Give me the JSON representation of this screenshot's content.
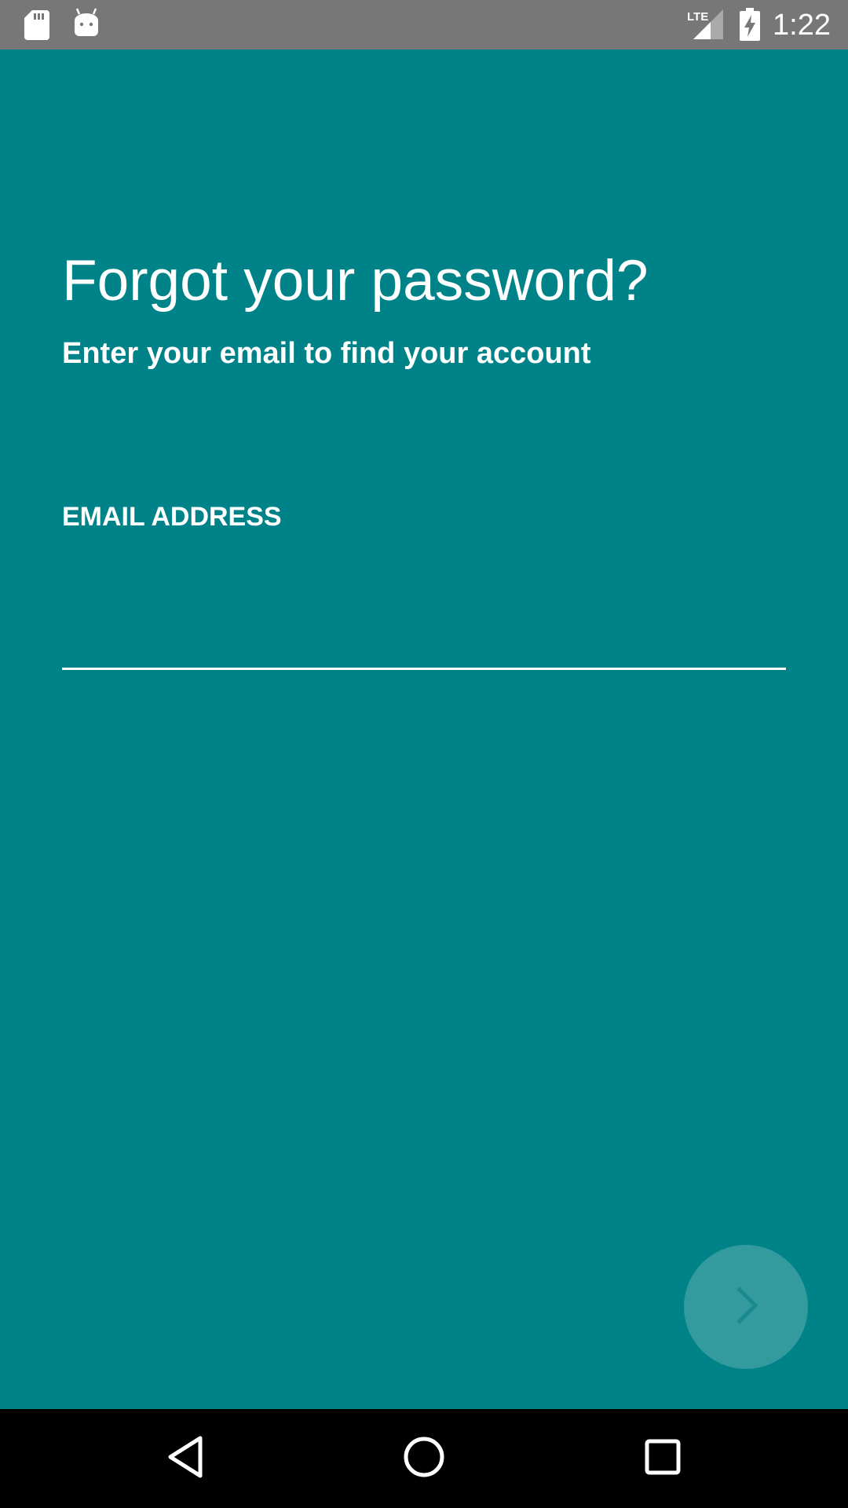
{
  "status_bar": {
    "time": "1:22",
    "network_label": "LTE",
    "icons": [
      "sd-card-icon",
      "android-debug-icon",
      "lte-signal-icon",
      "battery-charging-icon"
    ]
  },
  "forgot_password": {
    "title": "Forgot your password?",
    "subtitle": "Enter your email to find your account",
    "email_label": "EMAIL ADDRESS",
    "email_value": "",
    "next_button_icon": "chevron-right-icon",
    "next_button_enabled": false
  },
  "nav_bar": {
    "icons": [
      "back-icon",
      "home-icon",
      "recents-icon"
    ]
  },
  "colors": {
    "background": "#008388",
    "status_bar": "#777777",
    "fab_disabled": "#339a9e",
    "nav_bar": "#000000",
    "text": "#ffffff"
  }
}
